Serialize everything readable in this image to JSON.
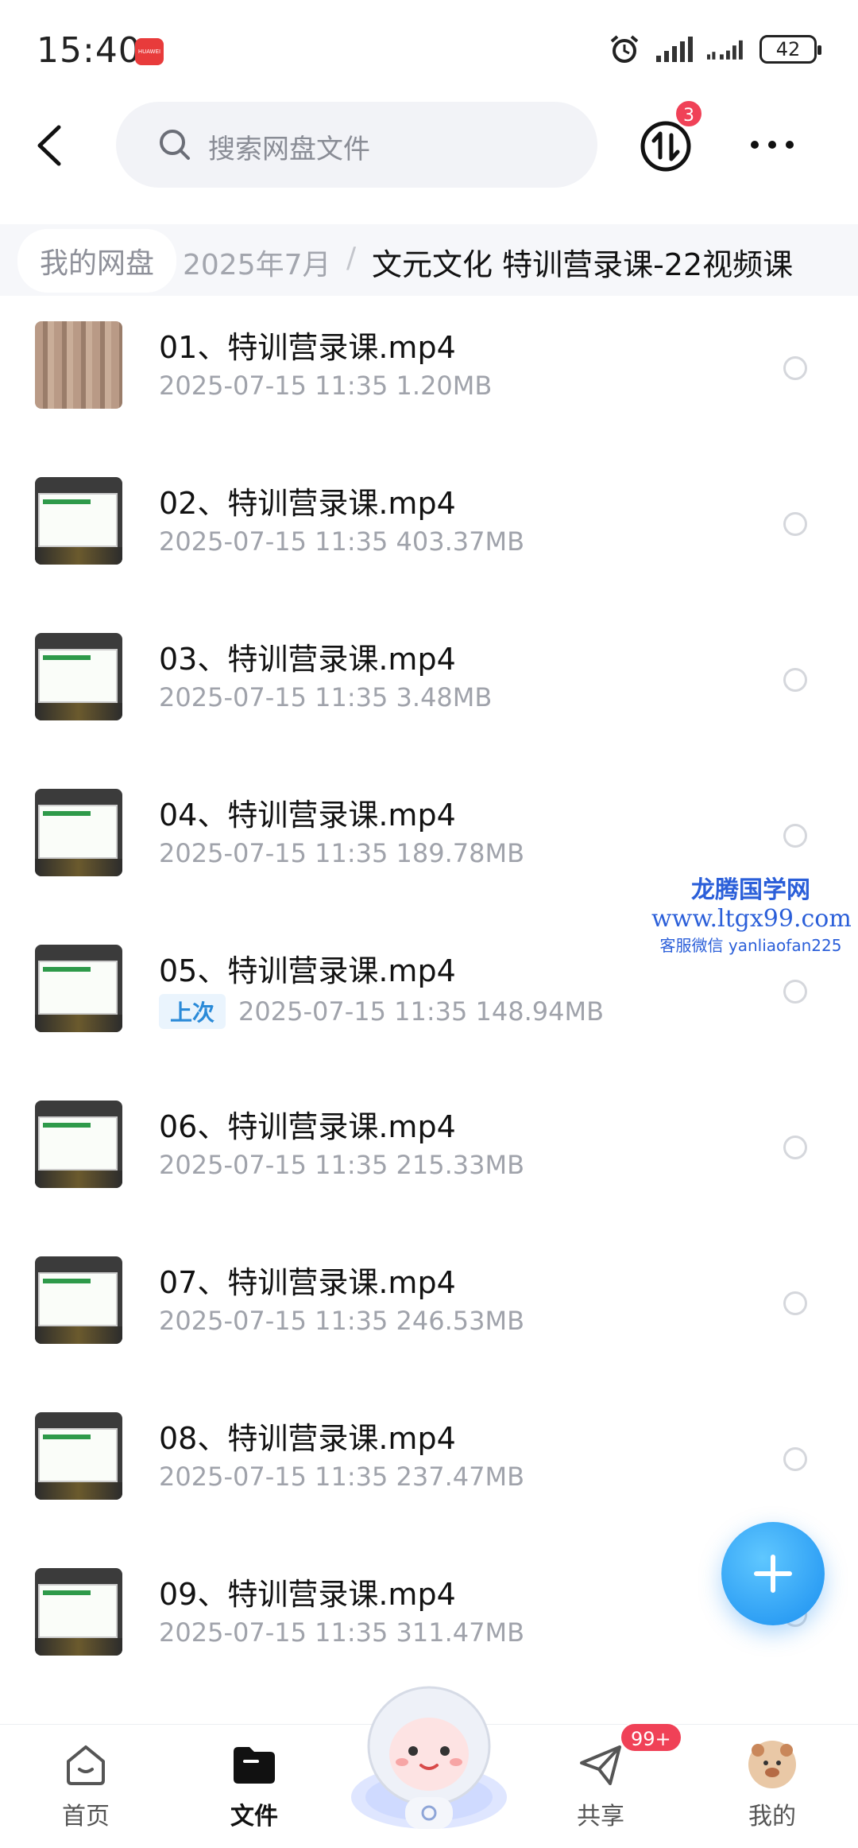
{
  "status": {
    "time": "15:40",
    "app_badge": "HUAWEI",
    "battery": "42"
  },
  "topbar": {
    "search_placeholder": "搜索网盘文件",
    "transfer_count": "3"
  },
  "breadcrumb": {
    "home": "我的网盘",
    "middle": "2025年7月",
    "separator": "/",
    "current": "文元文化 特训营录课-22视频课"
  },
  "files": [
    {
      "name": "01、特训营录课.mp4",
      "date": "2025-07-15",
      "time": "11:35",
      "size": "1.20MB",
      "tag": ""
    },
    {
      "name": "02、特训营录课.mp4",
      "date": "2025-07-15",
      "time": "11:35",
      "size": "403.37MB",
      "tag": ""
    },
    {
      "name": "03、特训营录课.mp4",
      "date": "2025-07-15",
      "time": "11:35",
      "size": "3.48MB",
      "tag": ""
    },
    {
      "name": "04、特训营录课.mp4",
      "date": "2025-07-15",
      "time": "11:35",
      "size": "189.78MB",
      "tag": ""
    },
    {
      "name": "05、特训营录课.mp4",
      "date": "2025-07-15",
      "time": "11:35",
      "size": "148.94MB",
      "tag": "上次"
    },
    {
      "name": "06、特训营录课.mp4",
      "date": "2025-07-15",
      "time": "11:35",
      "size": "215.33MB",
      "tag": ""
    },
    {
      "name": "07、特训营录课.mp4",
      "date": "2025-07-15",
      "time": "11:35",
      "size": "246.53MB",
      "tag": ""
    },
    {
      "name": "08、特训营录课.mp4",
      "date": "2025-07-15",
      "time": "11:35",
      "size": "237.47MB",
      "tag": ""
    },
    {
      "name": "09、特训营录课.mp4",
      "date": "2025-07-15",
      "time": "11:35",
      "size": "311.47MB",
      "tag": ""
    }
  ],
  "watermark": {
    "line1": "龙腾国学网",
    "line2": "www.ltgx99.com",
    "line3": "客服微信 yanliaofan225"
  },
  "nav": {
    "home": "首页",
    "files": "文件",
    "share": "共享",
    "share_badge": "99+",
    "mine": "我的"
  },
  "colors": {
    "accent": "#1a8ff0",
    "badge": "#f04157",
    "watermark": "#2b5fd9"
  }
}
